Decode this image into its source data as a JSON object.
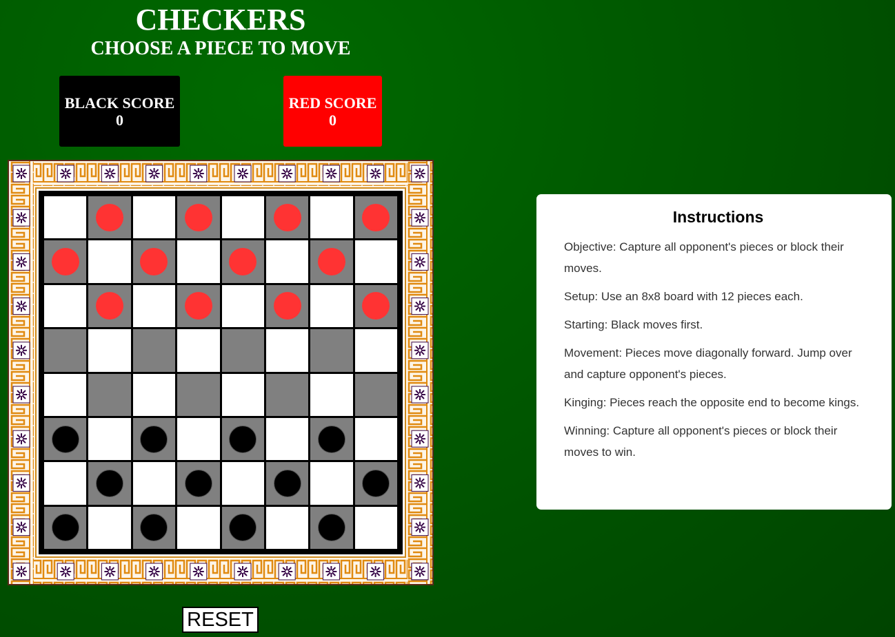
{
  "header": {
    "title": "CHECKERS",
    "status": "CHOOSE A PIECE TO MOVE"
  },
  "scores": {
    "black": {
      "label": "BLACK SCORE",
      "value": "0",
      "color": "#000000"
    },
    "red": {
      "label": "RED SCORE",
      "value": "0",
      "color": "#ff0000"
    }
  },
  "board": {
    "rows": [
      [
        "",
        "r",
        "",
        "r",
        "",
        "r",
        "",
        "r"
      ],
      [
        "r",
        "",
        "r",
        "",
        "r",
        "",
        "r",
        ""
      ],
      [
        "",
        "r",
        "",
        "r",
        "",
        "r",
        "",
        "r"
      ],
      [
        "",
        "",
        "",
        "",
        "",
        "",
        "",
        ""
      ],
      [
        "",
        "",
        "",
        "",
        "",
        "",
        "",
        ""
      ],
      [
        "b",
        "",
        "b",
        "",
        "b",
        "",
        "b",
        ""
      ],
      [
        "",
        "b",
        "",
        "b",
        "",
        "b",
        "",
        "b"
      ],
      [
        "b",
        "",
        "b",
        "",
        "b",
        "",
        "b",
        ""
      ]
    ],
    "colors": {
      "light_square": "#ffffff",
      "dark_square": "#808080",
      "red_piece": "#ff3333",
      "black_piece": "#000000"
    }
  },
  "controls": {
    "reset_label": "RESET"
  },
  "instructions": {
    "title": "Instructions",
    "items": [
      "Objective: Capture all opponent's pieces or block their moves.",
      "Setup: Use an 8x8 board with 12 pieces each.",
      "Starting: Black moves first.",
      "Movement: Pieces move diagonally forward. Jump over and capture opponent's pieces.",
      "Kinging: Pieces reach the opposite end to become kings.",
      "Winning: Capture all opponent's pieces or block their moves to win."
    ]
  },
  "theme": {
    "background": "#005a00",
    "border_orange": "#e08a10",
    "border_purple": "#3a0a4a"
  }
}
